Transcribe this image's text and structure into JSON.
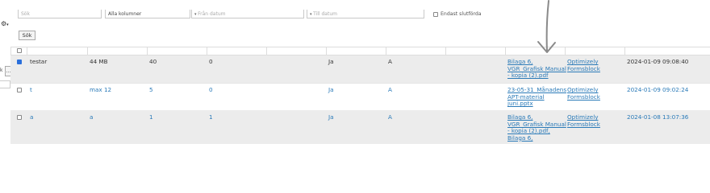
{
  "filters": {
    "search_placeholder": "Sök",
    "columns_select": "Alla kolumner",
    "from_date_placeholder": "Från datum",
    "to_date_placeholder": "Till datum",
    "only_unsigned_label": "Endast slutförda"
  },
  "toolbar": {
    "search_button": "Sök"
  },
  "left_fragments": {
    "a": "k",
    "b": "..."
  },
  "rows": [
    {
      "checked": true,
      "name": "testar",
      "size": "44 MB",
      "c3": "40",
      "c4": "0",
      "c5": "Ja",
      "c6": "A",
      "file": "Bilaga 6, VGR_Grafisk Manual - kopia (2).pdf",
      "file_lines": [
        "Bilaga 6,",
        "VGR_Grafisk Manual",
        "- kopia (2).pdf"
      ],
      "form": "Optimizely Formsblock",
      "form_lines": [
        "Optimizely",
        "Formsblock"
      ],
      "date": "2024-01-09 09:08:40"
    },
    {
      "checked": false,
      "name": "t",
      "size": "max 12",
      "c3": "5",
      "c4": "0",
      "c5": "Ja",
      "c6": "A",
      "file": "23-05-31_Månadens APT-material juni.pptx",
      "file_lines": [
        "23-05-31_Månadens",
        "APT-material",
        "juni.pptx"
      ],
      "form": "Optimizely Formsblock",
      "form_lines": [
        "Optimizely",
        "Formsblock"
      ],
      "date": "2024-01-09 09:02:24"
    },
    {
      "checked": false,
      "name": "a",
      "size": "a",
      "c3": "1",
      "c4": "1",
      "c5": "Ja",
      "c6": "A",
      "file": "Bilaga 6, VGR_Grafisk Manual - kopia (2).pdf, Bilaga 6,",
      "file_lines": [
        "Bilaga 6,",
        "VGR_Grafisk Manual",
        "- kopia (2).pdf,",
        "Bilaga 6,"
      ],
      "form": "Optimizely Formsblock",
      "form_lines": [
        "Optimizely",
        "Formsblock"
      ],
      "date": "2024-01-08 13:07:36"
    }
  ]
}
